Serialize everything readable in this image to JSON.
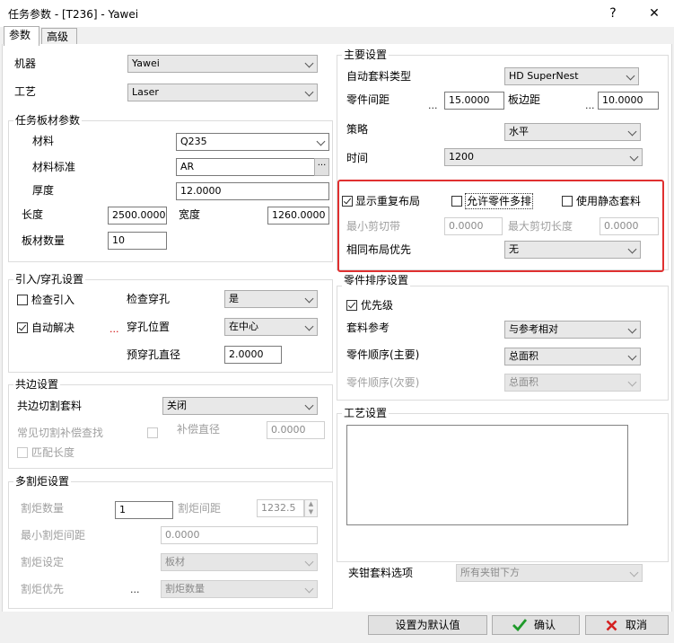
{
  "window": {
    "title": "任务参数 - [T236] - Yawei",
    "help": "?",
    "close": "✕"
  },
  "tabs": [
    {
      "label": "参数"
    },
    {
      "label": "高级"
    }
  ],
  "left": {
    "machine": {
      "label": "机器",
      "value": "Yawei"
    },
    "process": {
      "label": "工艺",
      "value": "Laser"
    },
    "sheet": {
      "title": "任务板材参数",
      "material": {
        "label": "材料",
        "value": "Q235"
      },
      "standard": {
        "label": "材料标准",
        "value": "AR",
        "btn": "···"
      },
      "thickness": {
        "label": "厚度",
        "value": "12.0000"
      },
      "length": {
        "label": "长度",
        "value": "2500.0000"
      },
      "width": {
        "label": "宽度",
        "value": "1260.0000"
      },
      "count": {
        "label": "板材数量",
        "value": "10"
      }
    },
    "leadin": {
      "title": "引入/穿孔设置",
      "check_leadin": "检查引入",
      "auto_solve": "自动解决",
      "dots": "...",
      "check_pierce": {
        "label": "检查穿孔",
        "value": "是"
      },
      "pierce_pos": {
        "label": "穿孔位置",
        "value": "在中心"
      },
      "pre_pierce": {
        "label": "预穿孔直径",
        "value": "2.0000"
      }
    },
    "common": {
      "title": "共边设置",
      "cut": {
        "label": "共边切割套料",
        "value": "关闭"
      },
      "comp_search": "常见切割补偿查找",
      "comp_dia": {
        "label": "补偿直径",
        "value": "0.0000"
      },
      "match_len": "匹配长度"
    },
    "multi": {
      "title": "多割炬设置",
      "count": {
        "label": "割炬数量",
        "value": "1"
      },
      "spacing": {
        "label": "割炬间距",
        "value": "1232.5"
      },
      "min_spacing": {
        "label": "最小割炬间距",
        "value": "0.0000"
      },
      "setting": {
        "label": "割炬设定",
        "value": "板材"
      },
      "priority": {
        "label": "割炬优先",
        "dots": "...",
        "value": "割炬数量"
      }
    }
  },
  "right": {
    "main": {
      "title": "主要设置",
      "auto_type": {
        "label": "自动套料类型",
        "value": "HD SuperNest"
      },
      "part_gap": {
        "label": "零件间距",
        "dots": "...",
        "value": "15.0000"
      },
      "edge_gap": {
        "label": "板边距",
        "dots": "...",
        "value": "10.0000"
      },
      "strategy": {
        "label": "策略",
        "value": "水平"
      },
      "time": {
        "label": "时间",
        "value": "1200"
      },
      "show_repeat": "显示重复布局",
      "allow_multi": "允许零件多排",
      "use_static": "使用静态套料",
      "min_strip": {
        "label": "最小剪切带",
        "value": "0.0000"
      },
      "max_cut": {
        "label": "最大剪切长度",
        "value": "0.0000"
      },
      "same_layout": {
        "label": "相同布局优先",
        "value": "无"
      }
    },
    "sort": {
      "title": "零件排序设置",
      "priority": "优先级",
      "nest_ref": {
        "label": "套料参考",
        "value": "与参考相对"
      },
      "order_main": {
        "label": "零件顺序(主要)",
        "value": "总面积"
      },
      "order_sub": {
        "label": "零件顺序(次要)",
        "value": "总面积"
      }
    },
    "process_title": "工艺设置",
    "clamp": {
      "label": "夹钳套料选项",
      "value": "所有夹钳下方"
    }
  },
  "footer": {
    "default": "设置为默认值",
    "ok": "确认",
    "cancel": "取消"
  }
}
